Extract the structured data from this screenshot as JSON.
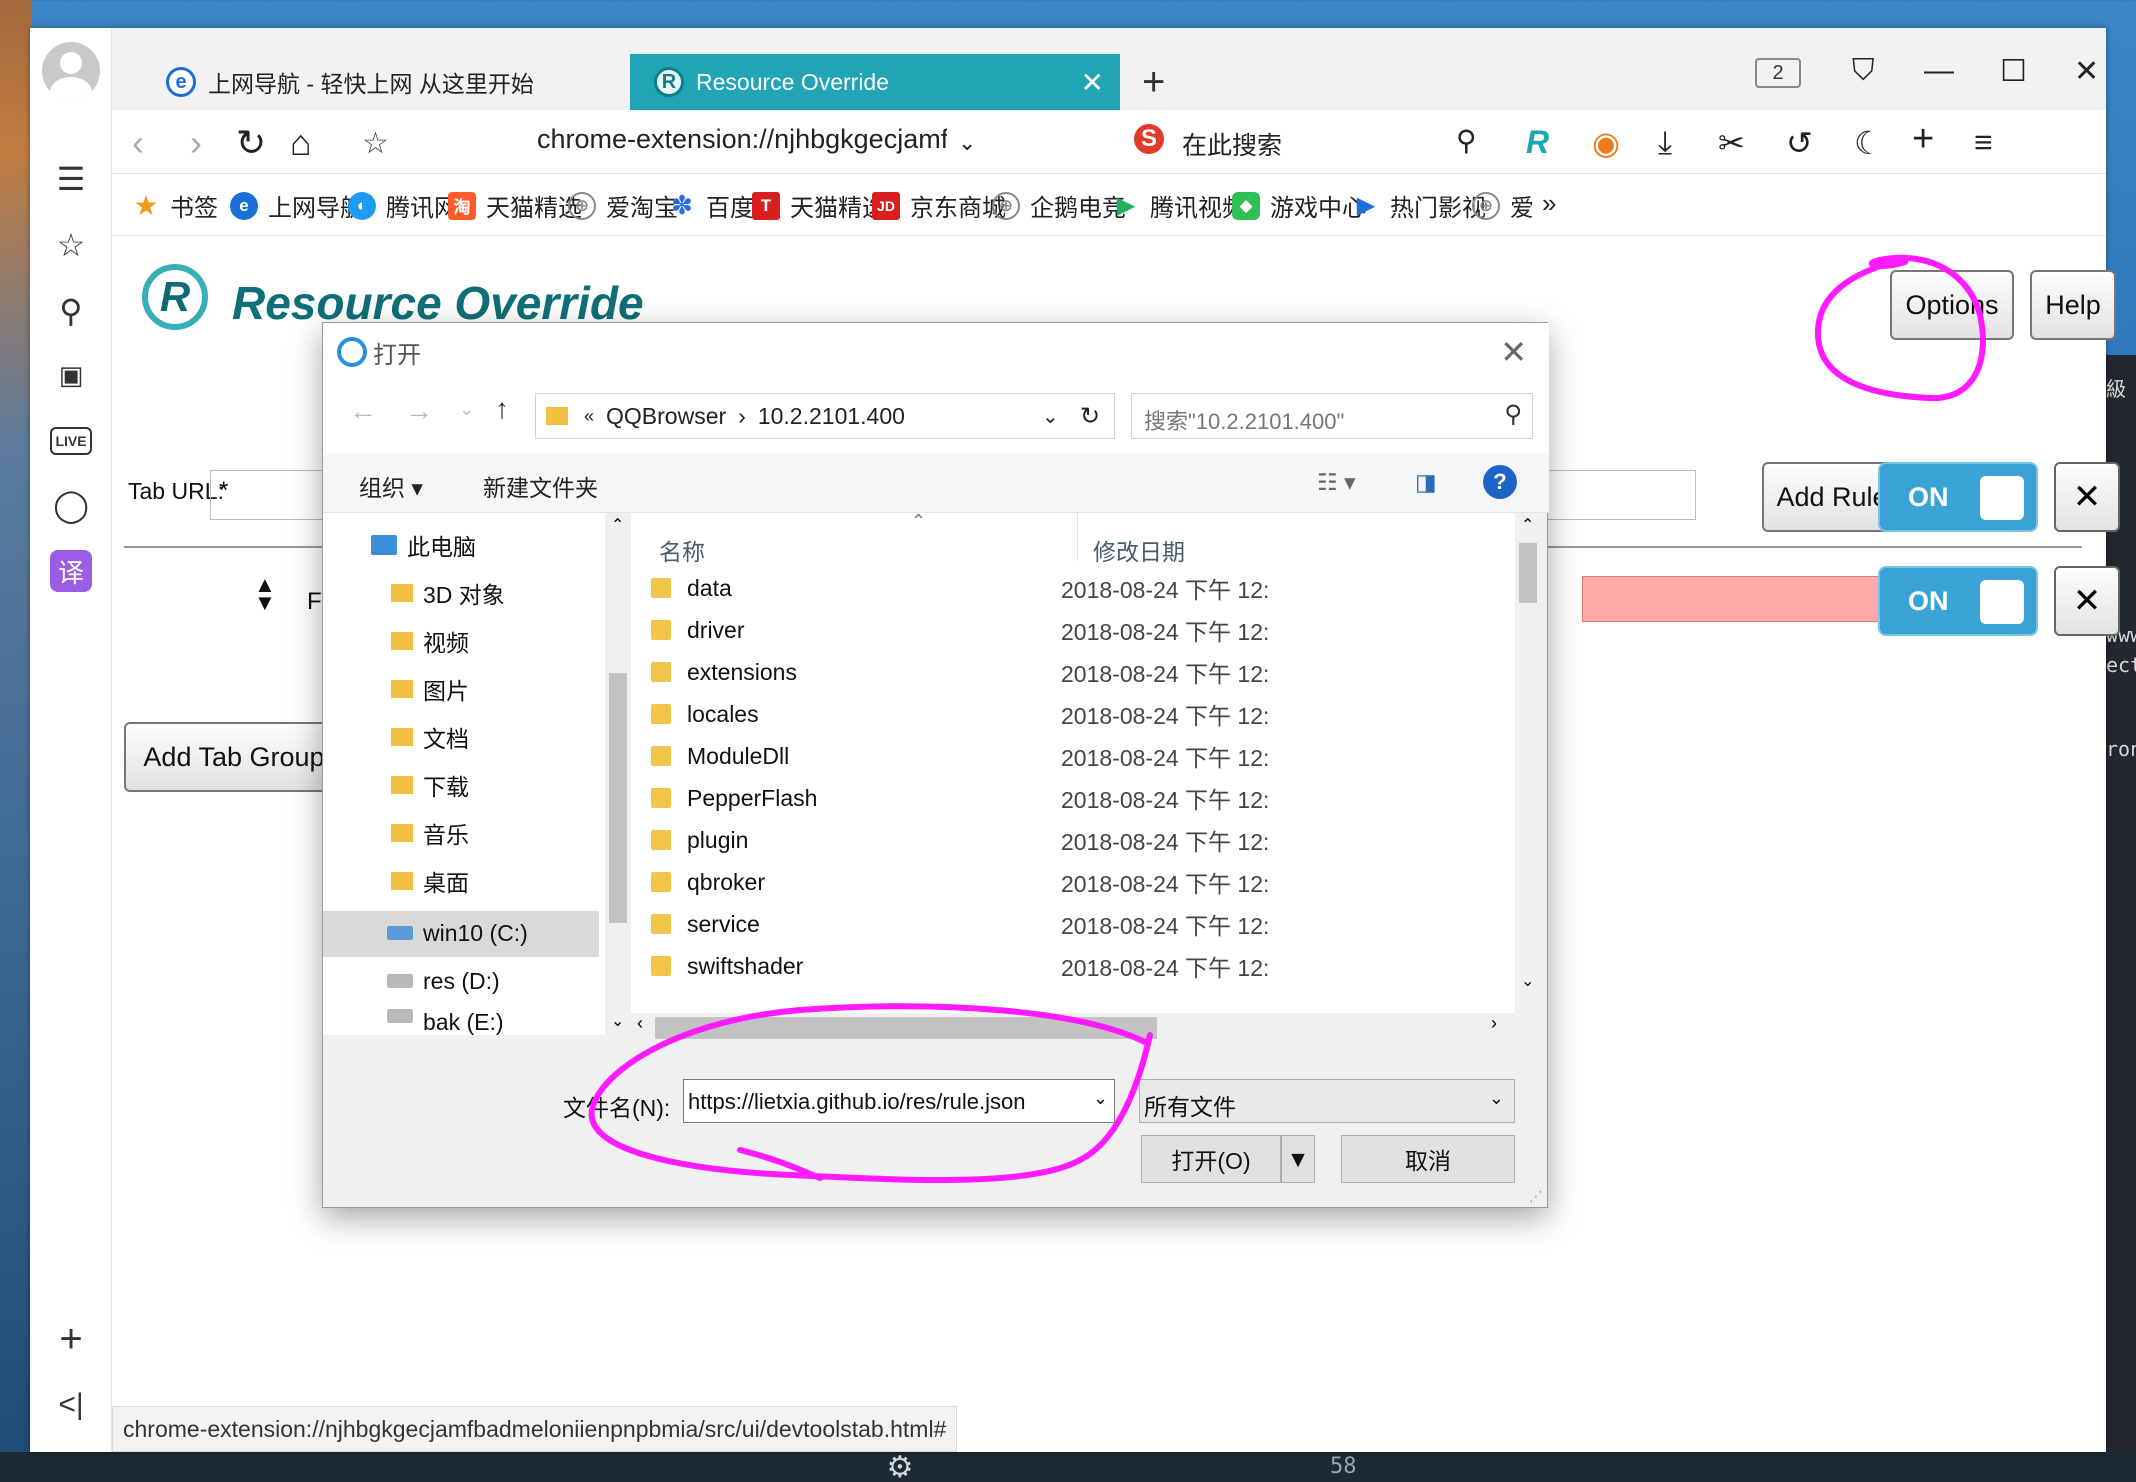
{
  "browser": {
    "tabs": [
      {
        "label": "上网导航 - 轻快上网 从这里开始",
        "icon": "ie-icon"
      },
      {
        "label": "Resource Override",
        "icon": "resource-override-icon"
      }
    ],
    "tab_count": "2",
    "address": "chrome-extension://njhbgkgecjamfbadme",
    "search_placeholder": "在此搜索",
    "bookmarks": [
      "书签",
      "上网导航",
      "腾讯网",
      "天猫精选",
      "爱淘宝",
      "百度",
      "天猫精选",
      "京东商城",
      "企鹅电竞",
      "腾讯视频",
      "游戏中心",
      "热门影视",
      "爱"
    ],
    "status_url": "chrome-extension://njhbgkgecjamfbadmeloniienpnpbmia/src/ui/devtoolstab.html#"
  },
  "page": {
    "brand": "Resource Override",
    "options_label": "Options",
    "help_label": "Help",
    "tab_url_label": "Tab URL:",
    "tab_url_value": "*",
    "add_rule_label": "Add Rule",
    "on_label": "ON",
    "close_glyph": "✕",
    "from_label": "From",
    "add_tab_group_label": "Add Tab Group"
  },
  "dialog": {
    "title": "打开",
    "path": [
      "«",
      "QQBrowser",
      "›",
      "10.2.2101.400"
    ],
    "search_placeholder": "搜索\"10.2.2101.400\"",
    "organize": "组织",
    "new_folder": "新建文件夹",
    "nav_items": [
      "此电脑",
      "3D 对象",
      "视频",
      "图片",
      "文档",
      "下载",
      "音乐",
      "桌面",
      "win10 (C:)",
      "res (D:)",
      "bak (E:)"
    ],
    "columns": {
      "name": "名称",
      "date": "修改日期"
    },
    "files": [
      {
        "name": "data",
        "date": "2018-08-24 下午 12:"
      },
      {
        "name": "driver",
        "date": "2018-08-24 下午 12:"
      },
      {
        "name": "extensions",
        "date": "2018-08-24 下午 12:"
      },
      {
        "name": "locales",
        "date": "2018-08-24 下午 12:"
      },
      {
        "name": "ModuleDll",
        "date": "2018-08-24 下午 12:"
      },
      {
        "name": "PepperFlash",
        "date": "2018-08-24 下午 12:"
      },
      {
        "name": "plugin",
        "date": "2018-08-24 下午 12:"
      },
      {
        "name": "qbroker",
        "date": "2018-08-24 下午 12:"
      },
      {
        "name": "service",
        "date": "2018-08-24 下午 12:"
      },
      {
        "name": "swiftshader",
        "date": "2018-08-24 下午 12:"
      }
    ],
    "filename_label": "文件名(N):",
    "filename_value": "https://lietxia.github.io/res/rule.json",
    "filetype": "所有文件",
    "open_label": "打开(O)",
    "cancel_label": "取消"
  },
  "background": {
    "editor_fragments": [
      "級",
      "www",
      "ect",
      "ron"
    ],
    "line_number": "58"
  },
  "colors": {
    "accent": "#21a4b5",
    "on_button": "#3aa3d6",
    "annotation": "#ff1aff",
    "rule_error": "#ffaaaa"
  }
}
